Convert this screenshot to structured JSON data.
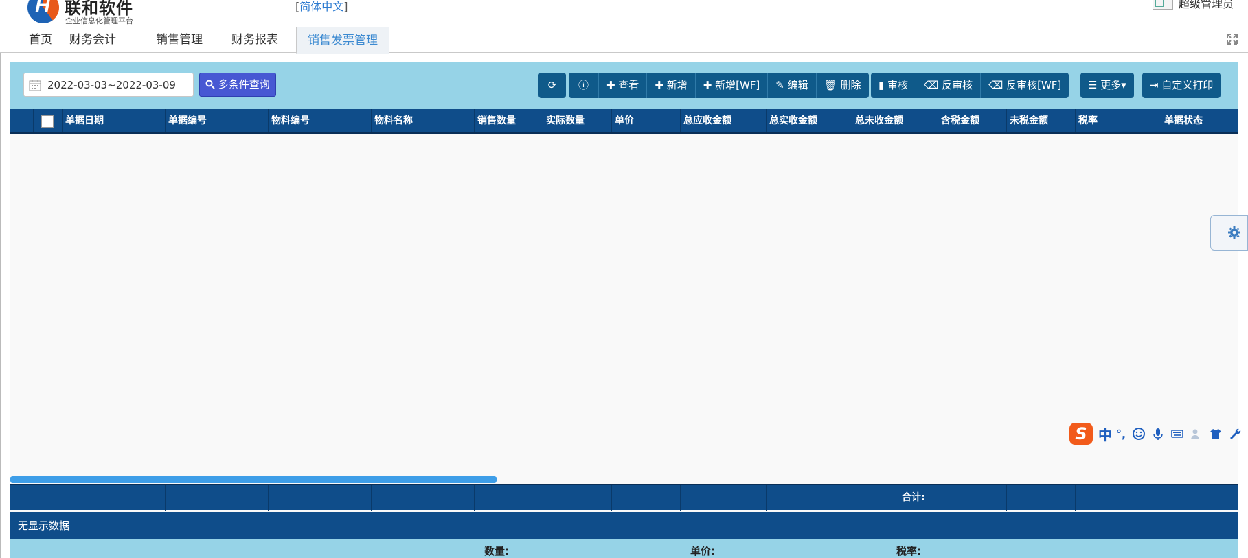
{
  "brand": {
    "name": "联和软件",
    "subtitle": "企业信息化管理平台",
    "logo_letter": "H"
  },
  "header": {
    "language": "简体中文",
    "user": "超级管理员"
  },
  "tabs": [
    {
      "label": "首页"
    },
    {
      "label": "财务会计"
    },
    {
      "label": "销售管理"
    },
    {
      "label": "财务报表"
    },
    {
      "label": "销售发票管理",
      "active": true
    }
  ],
  "filter": {
    "date_range": "2022-03-03~2022-03-09",
    "search_label": "多条件查询"
  },
  "toolbar": {
    "refresh": "",
    "help": "",
    "view": "查看",
    "add": "新增",
    "add_wf": "新增[WF]",
    "edit": "编辑",
    "delete": "删除",
    "audit": "审核",
    "unaudit": "反审核",
    "unaudit_wf": "反审核[WF]",
    "more": "更多",
    "custom_print": "自定义打印"
  },
  "table": {
    "columns": [
      "单据日期",
      "单据编号",
      "物料编号",
      "物料名称",
      "销售数量",
      "实际数量",
      "单价",
      "总应收金额",
      "总实收金额",
      "总未收金额",
      "含税金额",
      "未税金额",
      "税率",
      "单据状态"
    ],
    "rows": [],
    "total_label": "合计:",
    "empty_text": "无显示数据"
  },
  "summary": {
    "quantity_label": "数量:",
    "price_label": "单价:",
    "tax_label": "税率:"
  },
  "ime": {
    "zh": "中",
    "punct": "°,"
  },
  "colors": {
    "panel_bg": "#96d3e7",
    "table_header": "#0f4d8a",
    "search_btn": "#4758d3",
    "toolbar_btn": "#0f5a8a",
    "active_tab": "#3c8ad1"
  }
}
